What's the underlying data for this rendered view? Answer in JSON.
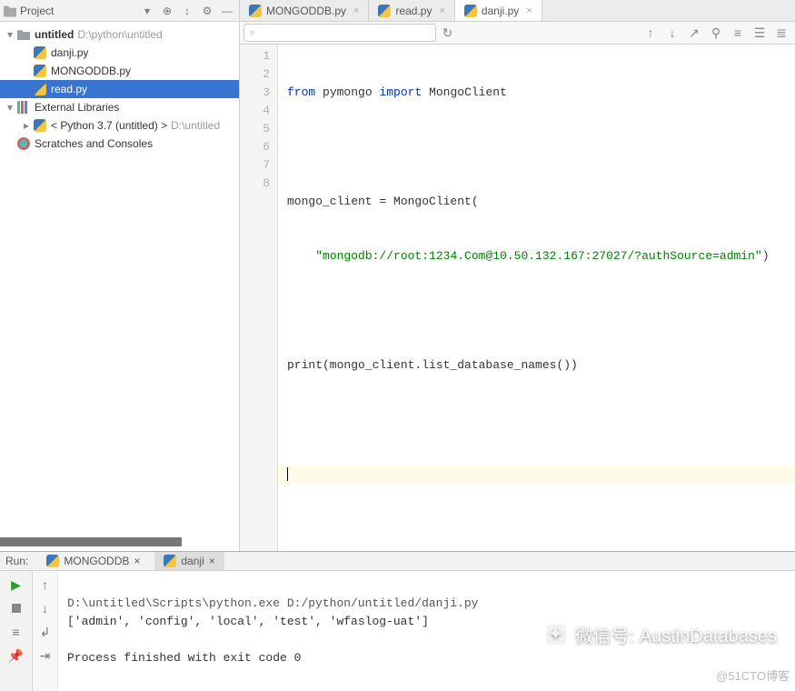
{
  "project": {
    "title": "Project",
    "root": {
      "name": "untitled",
      "path": "D:\\python\\untitled"
    },
    "files": [
      {
        "name": "danji.py"
      },
      {
        "name": "MONGODDB.py"
      },
      {
        "name": "read.py",
        "selected": true
      }
    ],
    "external_libs_label": "External Libraries",
    "python_sdk": {
      "label": "< Python 3.7 (untitled) >",
      "path_hint": "D:\\untitled"
    },
    "scratches_label": "Scratches and Consoles"
  },
  "editor": {
    "tabs": [
      {
        "label": "MONGODDB.py",
        "active": false
      },
      {
        "label": "read.py",
        "active": false
      },
      {
        "label": "danji.py",
        "active": true
      }
    ],
    "search_placeholder": "",
    "line_numbers": [
      1,
      2,
      3,
      4,
      5,
      6,
      7,
      8
    ],
    "code": {
      "l1_from": "from",
      "l1_mod": "pymongo",
      "l1_import": "import",
      "l1_sym": "MongoClient",
      "l3_lhs": "mongo_client = MongoClient(",
      "l4_str": "\"mongodb://root:1234.Com@10.50.132.167:27027/?authSource=admin\"",
      "l4_tail": ")",
      "l6": "print(mongo_client.list_database_names())"
    }
  },
  "run": {
    "label": "Run:",
    "tabs": [
      {
        "label": "MONGODDB",
        "active": false
      },
      {
        "label": "danji",
        "active": true
      }
    ],
    "console": {
      "line1": "D:\\untitled\\Scripts\\python.exe D:/python/untitled/danji.py",
      "line2": "['admin', 'config', 'local', 'test', 'wfaslog-uat']",
      "line3": "",
      "line4": "Process finished with exit code 0"
    }
  },
  "watermarks": {
    "w1": "微信号: AustinDatabases",
    "w2": "@51CTO博客"
  }
}
